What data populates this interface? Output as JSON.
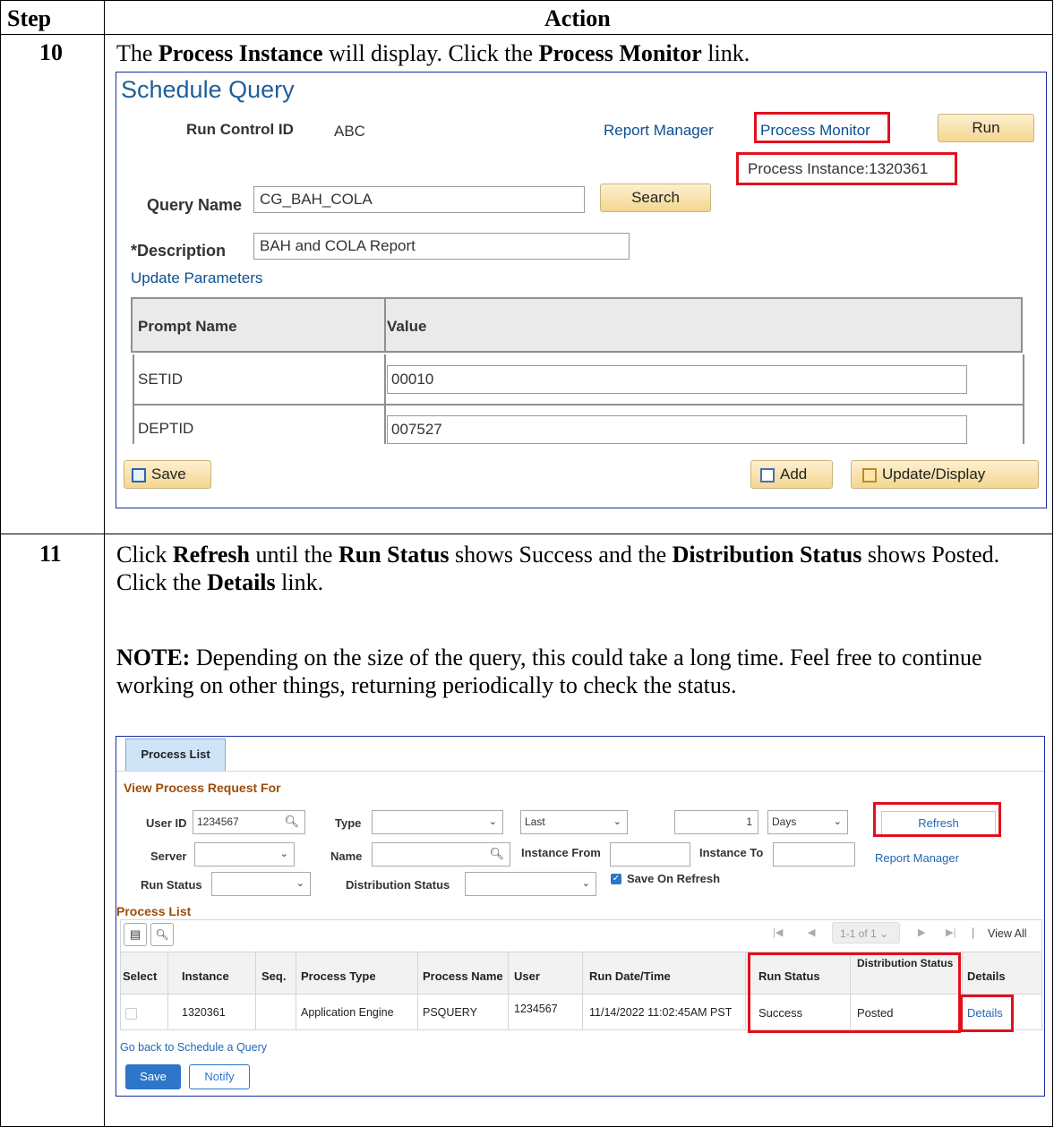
{
  "table": {
    "header_step": "Step",
    "header_action": "Action"
  },
  "step10": {
    "number": "10",
    "instruction_parts": [
      "The ",
      "Process Instance",
      " will display. Click the ",
      "Process Monitor",
      " link."
    ]
  },
  "schedule_query": {
    "title": "Schedule Query",
    "run_control_label": "Run Control ID",
    "run_control_value": "ABC",
    "report_manager_link": "Report Manager",
    "process_monitor_link": "Process Monitor",
    "run_button": "Run",
    "process_instance_text": "Process Instance:1320361",
    "query_name_label": "Query Name",
    "query_name_value": "CG_BAH_COLA",
    "search_button": "Search",
    "description_label": "*Description",
    "description_value": "BAH and COLA Report",
    "update_parameters_link": "Update Parameters",
    "grid_headers": [
      "Prompt Name",
      "Value"
    ],
    "grid_rows": [
      {
        "prompt": "SETID",
        "value": "00010"
      },
      {
        "prompt": "DEPTID",
        "value": "007527"
      }
    ],
    "save_button": "Save",
    "add_button": "Add",
    "update_display_button": "Update/Display"
  },
  "step11": {
    "number": "11",
    "instruction_parts": [
      "Click ",
      "Refresh",
      " until the ",
      "Run Status",
      " shows Success and the ",
      "Distribution Status",
      " shows Posted. Click the ",
      "Details",
      " link."
    ],
    "note_label": "NOTE:",
    "note_text": " Depending on the size of the query, this could take a long time. Feel free to continue working on other things, returning periodically to check the status."
  },
  "process_list": {
    "tab_label": "Process List",
    "view_title": "View Process Request For",
    "user_id_label": "User ID",
    "user_id_value": "1234567",
    "type_label": "Type",
    "type_value": "",
    "last_value": "Last",
    "days_count": "1",
    "days_unit": "Days",
    "refresh_link": "Refresh",
    "server_label": "Server",
    "name_label": "Name",
    "instance_from_label": "Instance From",
    "instance_to_label": "Instance To",
    "report_manager_link": "Report Manager",
    "run_status_label": "Run Status",
    "distribution_status_label": "Distribution Status",
    "save_on_refresh_label": "Save On Refresh",
    "save_on_refresh_checked": true,
    "section_title": "Process List",
    "pagination": "1-1 of 1",
    "view_all": "View All",
    "columns": [
      "Select",
      "Instance",
      "Seq.",
      "Process Type",
      "Process Name",
      "User",
      "Run Date/Time",
      "Run Status",
      "Distribution Status",
      "Details"
    ],
    "row": {
      "instance": "1320361",
      "seq": "",
      "process_type": "Application Engine",
      "process_name": "PSQUERY",
      "user": "1234567",
      "run_datetime": "11/14/2022 11:02:45AM PST",
      "run_status": "Success",
      "distribution_status": "Posted",
      "details": "Details"
    },
    "go_back_link": "Go back to Schedule a Query",
    "save_button": "Save",
    "notify_button": "Notify"
  },
  "colors": {
    "highlight": "#e0101d",
    "ps_link": "#0b4f90",
    "ps_title": "#1f5f9b",
    "section_title": "#9c4d0b",
    "primary_button": "#2e76c9"
  }
}
